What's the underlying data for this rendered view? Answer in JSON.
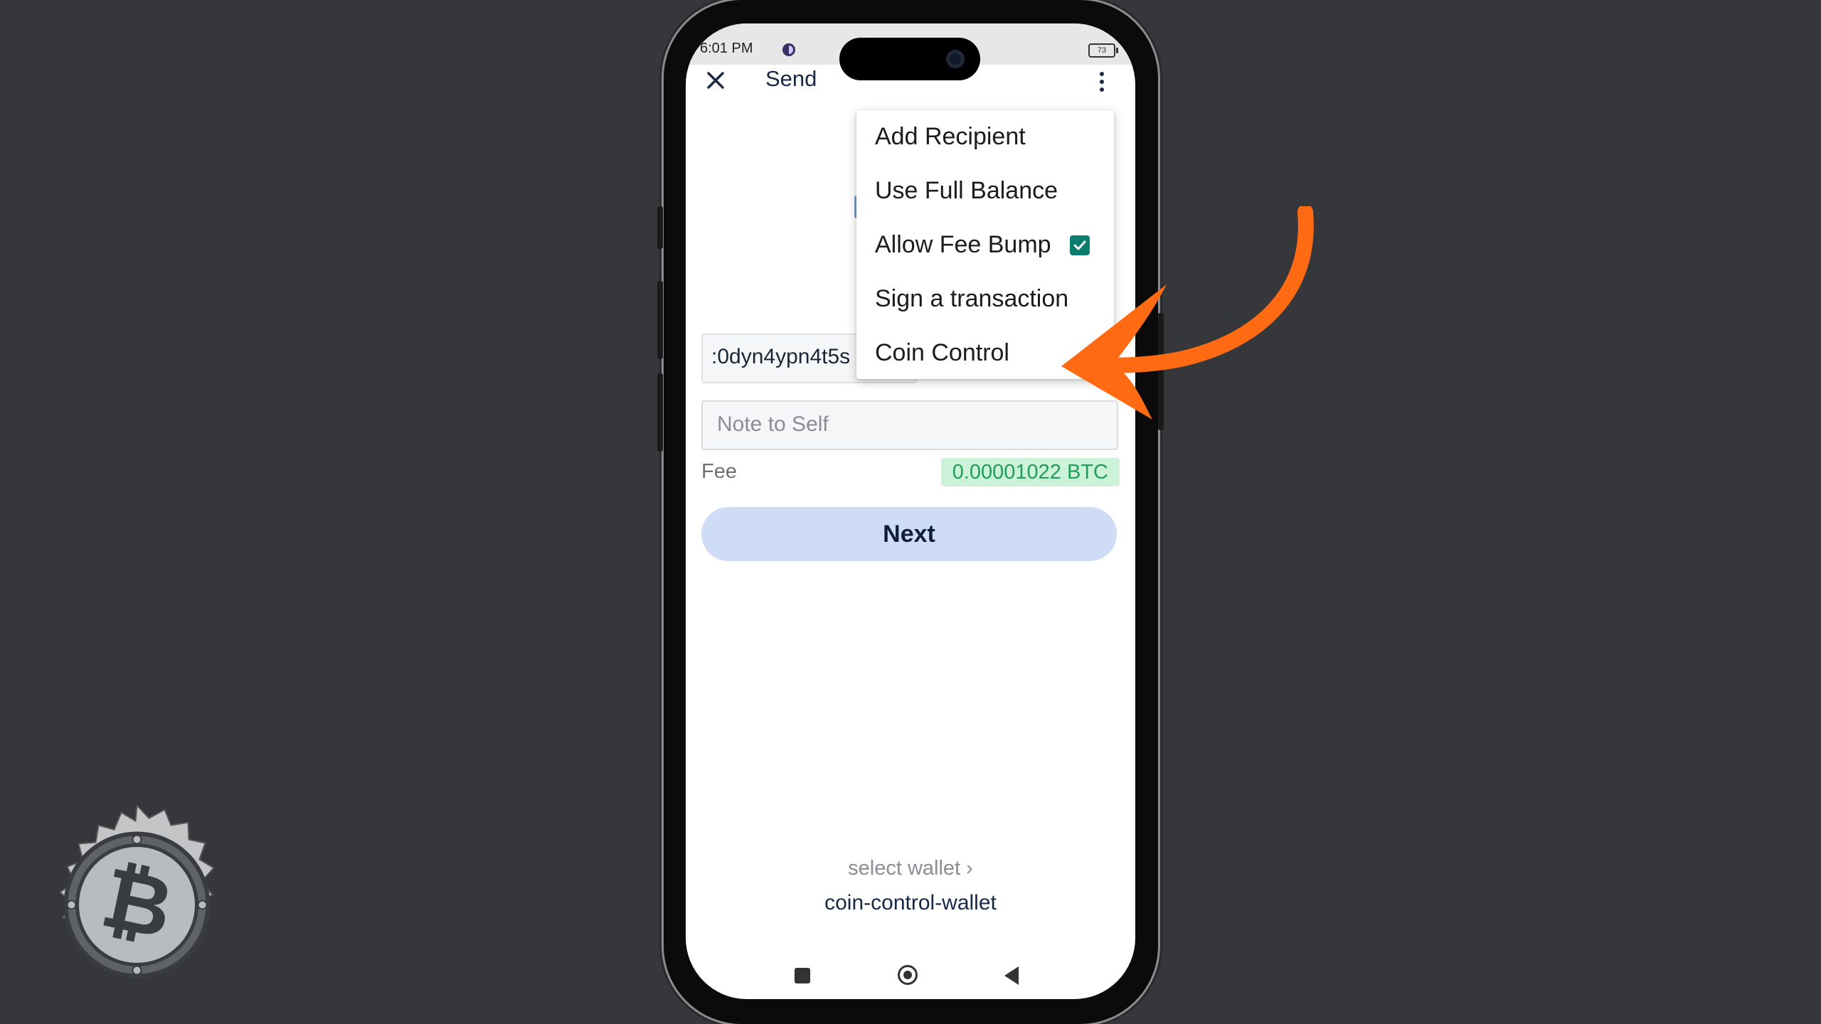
{
  "status_bar": {
    "time": "6:01 PM",
    "battery": "73"
  },
  "appbar": {
    "title": "Send",
    "close_icon": "close-icon",
    "more_icon": "more-vert-icon"
  },
  "form": {
    "address_value": ":0dyn4ypn4t5s",
    "note_placeholder": "Note to Self",
    "fee_label": "Fee",
    "fee_value": "0.00001022 BTC",
    "next_label": "Next"
  },
  "menu": {
    "items": [
      {
        "label": "Add Recipient"
      },
      {
        "label": "Use Full Balance"
      },
      {
        "label": "Allow Fee Bump",
        "checked": true
      },
      {
        "label": "Sign a transaction"
      },
      {
        "label": "Coin Control"
      }
    ]
  },
  "wallet": {
    "select_label": "select wallet ›",
    "name": "coin-control-wallet"
  },
  "colors": {
    "accent_orange": "#ff6a13",
    "fee_green": "#1f9e58",
    "check_teal": "#0b7d6f",
    "button_blue": "#cfdcf5"
  }
}
